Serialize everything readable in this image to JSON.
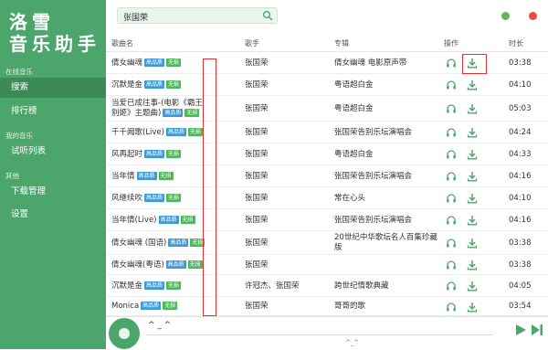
{
  "app": {
    "logo_line1": "洛雪",
    "logo_line2": "音乐助手"
  },
  "sidebar": {
    "sections": [
      {
        "title": "在线音乐",
        "items": [
          "搜索",
          "排行榜"
        ]
      },
      {
        "title": "我的音乐",
        "items": [
          "试听列表"
        ]
      },
      {
        "title": "其他",
        "items": [
          "下载管理",
          "设置"
        ]
      }
    ],
    "active_item": "搜索"
  },
  "search": {
    "value": "张国荣",
    "icon": "search-icon"
  },
  "window_controls": {
    "minimize_color": "#5fb65a",
    "close_color": "#f0493f"
  },
  "table": {
    "headers": {
      "title": "歌曲名",
      "artist": "歌手",
      "album": "专辑",
      "actions": "操作",
      "duration": "时长"
    },
    "rows": [
      {
        "title": "倩女幽魂",
        "badges": [
          "高品质",
          "无损"
        ],
        "artist": "张国荣",
        "album": "倩女幽魂 电影原声带",
        "duration": "03:38"
      },
      {
        "title": "沉默是金",
        "badges": [
          "高品质",
          "无损"
        ],
        "artist": "张国荣",
        "album": "粤语超白金",
        "duration": "04:10"
      },
      {
        "title": "当爱已成往事-(电影《霸王别姬》主题曲)",
        "badges": [
          "高品质",
          "无损"
        ],
        "artist": "张国荣",
        "album": "粤语超白金",
        "duration": "05:03"
      },
      {
        "title": "千千阙歌(Live)",
        "badges": [
          "高品质",
          "无损"
        ],
        "artist": "张国荣",
        "album": "张国荣告别乐坛演唱会",
        "duration": "04:24"
      },
      {
        "title": "风再起时",
        "badges": [
          "高品质",
          "无损"
        ],
        "artist": "张国荣",
        "album": "粤语超白金",
        "duration": "04:33"
      },
      {
        "title": "当年情",
        "badges": [
          "高品质",
          "无损"
        ],
        "artist": "张国荣",
        "album": "张国荣告别乐坛演唱会",
        "duration": "04:16"
      },
      {
        "title": "风继续吹",
        "badges": [
          "高品质",
          "无损"
        ],
        "artist": "张国荣",
        "album": "常在心头",
        "duration": "04:10"
      },
      {
        "title": "当年情(Live)",
        "badges": [
          "高品质",
          "无损"
        ],
        "artist": "张国荣",
        "album": "张国荣告别乐坛演唱会",
        "duration": "04:16"
      },
      {
        "title": "倩女幽魂 (国语)",
        "badges": [
          "高品质",
          "无损"
        ],
        "artist": "张国荣",
        "album": "20世纪中华歌坛名人百集珍藏版",
        "duration": "03:38"
      },
      {
        "title": "倩女幽魂(粤语)",
        "badges": [
          "高品质",
          "无损"
        ],
        "artist": "张国荣",
        "album": "",
        "duration": "03:38"
      },
      {
        "title": "沉默是金",
        "badges": [
          "高品质",
          "无损"
        ],
        "artist": "许冠杰、张国荣",
        "album": "跨世纪情歌典藏",
        "duration": "04:05"
      },
      {
        "title": "Monica",
        "badges": [
          "高品质",
          "无损"
        ],
        "artist": "张国荣",
        "album": "哥哥的歌",
        "duration": "03:54"
      }
    ],
    "row_icons": {
      "listen": "headphones-icon",
      "download": "download-icon"
    }
  },
  "player": {
    "now_playing": "^ _ ^",
    "bottom_text": "^_^"
  },
  "colors": {
    "accent": "#4ca66b",
    "accent_dark": "#3c8a57",
    "annotation": "#e53030"
  }
}
